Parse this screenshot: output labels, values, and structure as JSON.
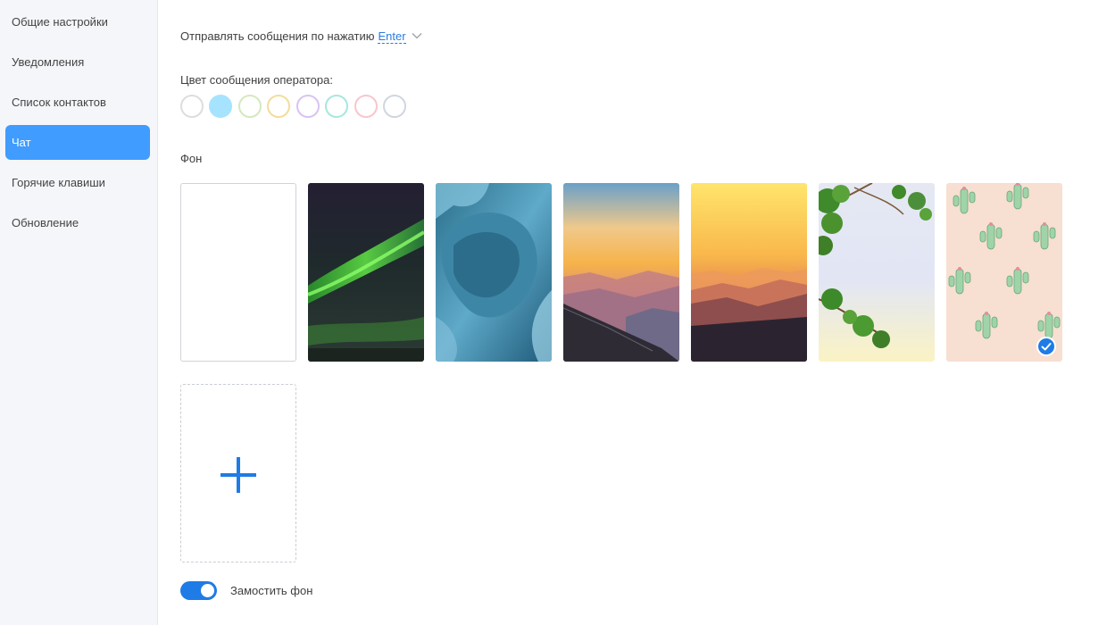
{
  "sidebar": {
    "items": [
      {
        "label": "Общие настройки"
      },
      {
        "label": "Уведомления"
      },
      {
        "label": "Список контактов"
      },
      {
        "label": "Чат",
        "active": true
      },
      {
        "label": "Горячие клавиши"
      },
      {
        "label": "Обновление"
      }
    ]
  },
  "chat": {
    "send_label": "Отправлять сообщения по нажатию",
    "send_key": "Enter",
    "operator_color_label": "Цвет сообщения оператора:",
    "operator_colors": [
      "#dddddd",
      "#a6e3ff",
      "#d4e8bf",
      "#f4dc9a",
      "#d8c3f3",
      "#a6e7df",
      "#f8c6cc",
      "#d0d6df"
    ],
    "selected_color": "#a6e3ff",
    "background_label": "Фон",
    "backgrounds": [
      "blank",
      "aurora",
      "ice-cave",
      "mountain-sunset",
      "orange-mountains",
      "tree-branches",
      "cactus-pattern"
    ],
    "selected_background": "cactus-pattern",
    "tile_label": "Замостить фон",
    "tile_enabled": true
  },
  "colors": {
    "accent": "#409cff",
    "primary_blue": "#1f7be6"
  }
}
